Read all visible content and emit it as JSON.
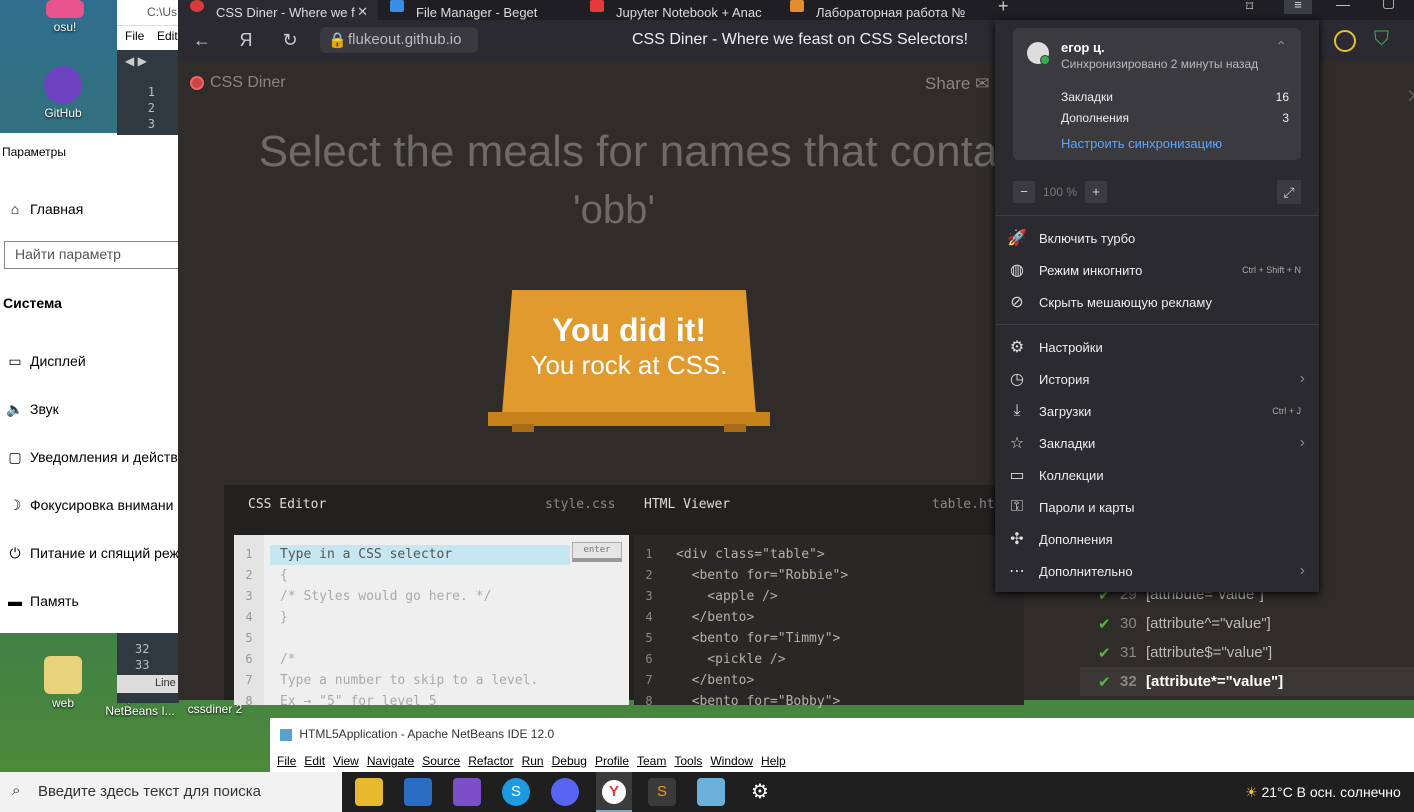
{
  "desktop": {
    "icons": [
      {
        "label": "osu!"
      },
      {
        "label": "GitHub Desktop"
      },
      {
        "label": "web"
      },
      {
        "label": "Apache NetBeans I..."
      },
      {
        "label": "cssdiner 2"
      }
    ]
  },
  "settings": {
    "title": "Параметры",
    "home": "Главная",
    "search_placeholder": "Найти параметр",
    "section": "Система",
    "items": [
      "Дисплей",
      "Звук",
      "Уведомления и действ",
      "Фокусировка внимани",
      "Питание и спящий реж",
      "Память"
    ]
  },
  "sublime": {
    "path": "C:\\Us",
    "menu_file": "File",
    "menu_edit": "Edit",
    "lines": [
      "1",
      "2",
      "3"
    ],
    "bottom_lines": [
      "32",
      "33"
    ],
    "status": "Line"
  },
  "browser": {
    "tabs": [
      {
        "label": "CSS Diner - Where we f",
        "color": "#d93b3b"
      },
      {
        "label": "File Manager - Beget",
        "color": "#3a8ee6"
      },
      {
        "label": "Jupyter Notebook + Anac",
        "color": "#e63a3a"
      },
      {
        "label": "Лабораторная работа №",
        "color": "#e68a2e"
      }
    ],
    "url": "flukeout.github.io",
    "page_title": "CSS Diner - Where we feast on CSS Selectors!"
  },
  "page": {
    "logo": "CSS Diner",
    "share": "Share",
    "heading_line1": "Select the meals for names that conta",
    "heading_line2": "'obb'",
    "did_it": "You did it!",
    "rock": "You rock at CSS.",
    "css_editor_title": "CSS Editor",
    "css_file": "style.css",
    "html_viewer_title": "HTML Viewer",
    "html_file": "table.htm",
    "enter": "enter",
    "css_lines": [
      {
        "n": "1",
        "t": "Type in a CSS selector"
      },
      {
        "n": "2",
        "t": "{"
      },
      {
        "n": "3",
        "t": "/* Styles would go here. */"
      },
      {
        "n": "4",
        "t": "}"
      },
      {
        "n": "5",
        "t": ""
      },
      {
        "n": "6",
        "t": "/*"
      },
      {
        "n": "7",
        "t": "Type a number to skip to a level."
      },
      {
        "n": "8",
        "t": "Ex → \"5\" for level 5"
      }
    ],
    "html_lines": [
      {
        "n": "1",
        "t": "<div class=\"table\">"
      },
      {
        "n": "2",
        "t": "  <bento for=\"Robbie\">"
      },
      {
        "n": "3",
        "t": "    <apple />"
      },
      {
        "n": "4",
        "t": "  </bento>"
      },
      {
        "n": "5",
        "t": "  <bento for=\"Timmy\">"
      },
      {
        "n": "6",
        "t": "    <pickle />"
      },
      {
        "n": "7",
        "t": "  </bento>"
      },
      {
        "n": "8",
        "t": "  <bento for=\"Bobby\">"
      }
    ],
    "levels": [
      {
        "n": "29",
        "t": "[attribute=\"value\"]"
      },
      {
        "n": "30",
        "t": "[attribute^=\"value\"]"
      },
      {
        "n": "31",
        "t": "[attribute$=\"value\"]"
      },
      {
        "n": "32",
        "t": "[attribute*=\"value\"]"
      }
    ]
  },
  "menu": {
    "user": "егор ц.",
    "sync_status": "Синхронизировано 2 минуты назад",
    "bookmarks_label": "Закладки",
    "bookmarks_count": "16",
    "addons_label": "Дополнения",
    "addons_count": "3",
    "sync_settings": "Настроить синхронизацию",
    "zoom": "100 %",
    "zoom_minus": "−",
    "zoom_plus": "+",
    "items": [
      {
        "label": "Включить турбо",
        "icon": "rocket-icon",
        "glyph": "🚀"
      },
      {
        "label": "Режим инкогнито",
        "icon": "mask-icon",
        "glyph": "◍",
        "shortcut": "Ctrl + Shift + N"
      },
      {
        "label": "Скрыть мешающую рекламу",
        "icon": "block-icon",
        "glyph": "⊘"
      },
      {
        "label": "Настройки",
        "icon": "gear-icon",
        "glyph": "⚙"
      },
      {
        "label": "История",
        "icon": "clock-icon",
        "glyph": "◷",
        "arrow": "›"
      },
      {
        "label": "Загрузки",
        "icon": "download-icon",
        "glyph": "⤓",
        "shortcut": "Ctrl + J"
      },
      {
        "label": "Закладки",
        "icon": "star-icon",
        "glyph": "☆",
        "arrow": "›"
      },
      {
        "label": "Коллекции",
        "icon": "collection-icon",
        "glyph": "▭"
      },
      {
        "label": "Пароли и карты",
        "icon": "key-icon",
        "glyph": "⚿"
      },
      {
        "label": "Дополнения",
        "icon": "puzzle-icon",
        "glyph": "✣"
      },
      {
        "label": "Дополнительно",
        "icon": "more-icon",
        "glyph": "⋯",
        "arrow": "›"
      }
    ]
  },
  "netbeans": {
    "title": "HTML5Application - Apache NetBeans IDE 12.0",
    "menu": [
      "File",
      "Edit",
      "View",
      "Navigate",
      "Source",
      "Refactor",
      "Run",
      "Debug",
      "Profile",
      "Team",
      "Tools",
      "Window",
      "Help"
    ]
  },
  "taskbar": {
    "search_placeholder": "Введите здесь текст для поиска",
    "weather": "21°C  В осн. солнечно"
  }
}
